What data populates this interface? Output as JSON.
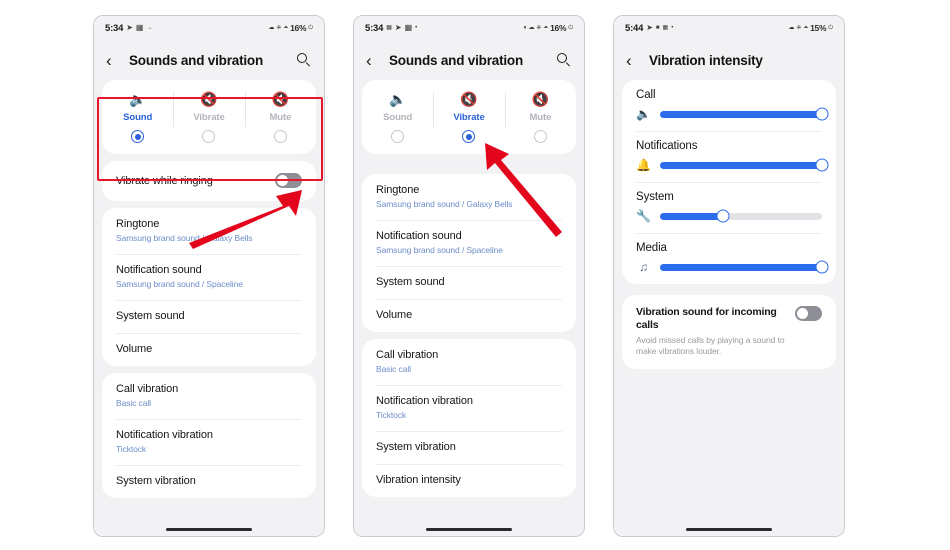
{
  "accent_blue": "#2b62d9",
  "slider_blue": "#2b6ced",
  "annotation_red": "#e8162a",
  "phones": [
    {
      "id": "phone-1",
      "status": {
        "time": "5:34",
        "left_icons": [
          "navigation-icon",
          "sim-icon",
          "arrow-icon"
        ],
        "right_icons": [
          "wifi-icon",
          "bluetooth-icon",
          "signal-icon"
        ],
        "battery": "16%"
      },
      "title": "Sounds and vibration",
      "back_label": "‹",
      "search_name": "search-icon",
      "mode_selector": {
        "options": [
          {
            "label": "Sound",
            "icon": "speaker-on-icon",
            "selected": true
          },
          {
            "label": "Vibrate",
            "icon": "vibrate-icon",
            "selected": false
          },
          {
            "label": "Mute",
            "icon": "speaker-mute-icon",
            "selected": false
          }
        ]
      },
      "toggle_row": {
        "label": "Vibrate while ringing",
        "state": "off"
      },
      "sections": [
        {
          "rows": [
            {
              "title": "Ringtone",
              "sub": "Samsung brand sound / Galaxy Bells"
            },
            {
              "title": "Notification sound",
              "sub": "Samsung brand sound / Spaceline"
            },
            {
              "title": "System sound",
              "sub": ""
            },
            {
              "title": "Volume",
              "sub": ""
            }
          ]
        },
        {
          "rows": [
            {
              "title": "Call vibration",
              "sub": "Basic call"
            },
            {
              "title": "Notification vibration",
              "sub": "Ticktock"
            },
            {
              "title": "System vibration",
              "sub": ""
            }
          ]
        }
      ]
    },
    {
      "id": "phone-2",
      "status": {
        "time": "5:34",
        "left_icons": [
          "calendar-icon",
          "navigation-icon",
          "sim-icon",
          "dot-icon"
        ],
        "right_icons": [
          "mute-icon",
          "wifi-icon",
          "bluetooth-icon",
          "signal-icon"
        ],
        "battery": "16%"
      },
      "title": "Sounds and vibration",
      "back_label": "‹",
      "search_name": "search-icon",
      "mode_selector": {
        "options": [
          {
            "label": "Sound",
            "icon": "speaker-on-icon",
            "selected": false
          },
          {
            "label": "Vibrate",
            "icon": "vibrate-icon",
            "selected": true
          },
          {
            "label": "Mute",
            "icon": "speaker-mute-icon",
            "selected": false
          }
        ]
      },
      "sections": [
        {
          "rows": [
            {
              "title": "Ringtone",
              "sub": "Samsung brand sound / Galaxy Bells"
            },
            {
              "title": "Notification sound",
              "sub": "Samsung brand sound / Spaceline"
            },
            {
              "title": "System sound",
              "sub": ""
            },
            {
              "title": "Volume",
              "sub": ""
            }
          ]
        },
        {
          "rows": [
            {
              "title": "Call vibration",
              "sub": "Basic call"
            },
            {
              "title": "Notification vibration",
              "sub": "Ticktock"
            },
            {
              "title": "System vibration",
              "sub": ""
            },
            {
              "title": "Vibration intensity",
              "sub": ""
            }
          ]
        }
      ]
    },
    {
      "id": "phone-3",
      "status": {
        "time": "5:44",
        "left_icons": [
          "navigation-icon",
          "battery-saver-icon",
          "calendar-icon",
          "dot-icon"
        ],
        "right_icons": [
          "wifi-icon",
          "bluetooth-icon",
          "signal-icon"
        ],
        "battery": "15%"
      },
      "title": "Vibration intensity",
      "back_label": "‹",
      "sliders": [
        {
          "label": "Call",
          "icon": "speaker-on-icon",
          "value": 100
        },
        {
          "label": "Notifications",
          "icon": "bell-icon",
          "value": 100
        },
        {
          "label": "System",
          "icon": "wrench-icon",
          "value": 39
        },
        {
          "label": "Media",
          "icon": "music-note-icon",
          "value": 100
        }
      ],
      "desc_row": {
        "title": "Vibration sound for incoming calls",
        "sub": "Avoid missed calls by playing a sound to make vibrations louder.",
        "state": "off"
      }
    }
  ]
}
